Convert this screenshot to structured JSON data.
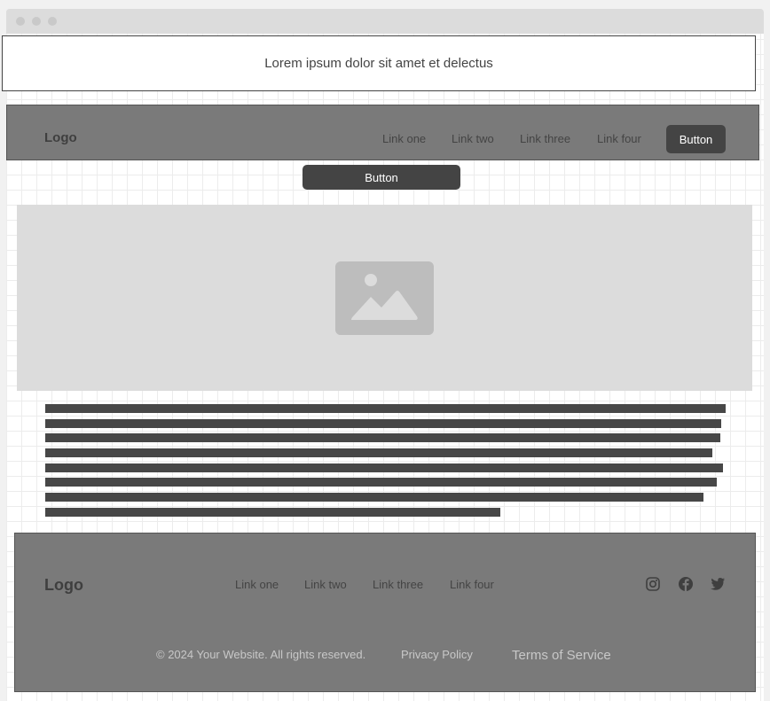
{
  "banner": {
    "text": "Lorem ipsum dolor sit amet et delectus"
  },
  "navbar": {
    "logo": "Logo",
    "links": [
      "Link one",
      "Link two",
      "Link three",
      "Link four"
    ],
    "button_label": "Button"
  },
  "secondary_button_label": "Button",
  "hero": {
    "image_icon": "image-placeholder-icon"
  },
  "body_text": {
    "line_count": 8
  },
  "footer": {
    "logo": "Logo",
    "links": [
      "Link one",
      "Link two",
      "Link three",
      "Link four"
    ],
    "copyright": "© 2024 Your Website. All rights reserved.",
    "privacy": "Privacy Policy",
    "terms": "Terms of Service",
    "social_icons": [
      "instagram-icon",
      "facebook-icon",
      "twitter-icon"
    ]
  },
  "colors": {
    "nav_bg": "#7a7a7a",
    "button_bg": "#444444",
    "placeholder_bg": "#dcdcdc"
  }
}
